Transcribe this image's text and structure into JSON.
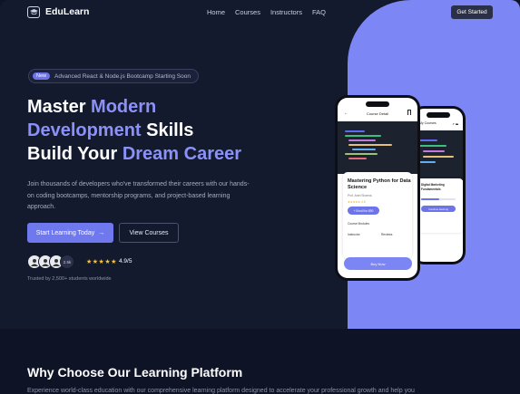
{
  "brand": {
    "name": "EduLearn"
  },
  "nav": {
    "links": [
      "Home",
      "Courses",
      "Instructors",
      "FAQ"
    ],
    "cta": "Get Started"
  },
  "hero": {
    "badge_tag": "New",
    "badge_text": "Advanced React & Node.js Bootcamp Starting Soon",
    "headline": {
      "part1": "Master ",
      "part2": "Modern",
      "part3": "Development",
      "part4": " Skills",
      "part5": "Build Your ",
      "part6": "Dream Career"
    },
    "description": "Join thousands of developers who've transformed their careers with our hands-on coding bootcamps, mentorship programs, and project-based learning approach.",
    "primary_button": "Start Learning Today",
    "primary_arrow": "→",
    "secondary_button": "View Courses",
    "avatar_count": "2.5k",
    "stars": "★★★★★",
    "rating": "4.9/5",
    "trusted": "Trusted by 2,500+ students worldwide"
  },
  "phone_front": {
    "header": "Course Detail",
    "course_title": "Mastering Python for Data Science",
    "author": "Prof. Aniel Sharma",
    "stars": "★★★★★ 4.8",
    "enroll": "+ Enroll for $90",
    "modules": "Course Modules",
    "instructor": "Instructor",
    "reviews": "Reviews",
    "buy": "Buy Now"
  },
  "phone_back": {
    "header": "My Courses",
    "course_title": "Digital Marketing Fundamentals",
    "button": "Continue learning"
  },
  "section": {
    "title": "Why Choose Our Learning Platform",
    "subtitle": "Experience world-class education with our comprehensive learning platform designed to accelerate your professional growth and help you"
  },
  "colors": {
    "accent": "#7078ee",
    "panel": "#7c86f5",
    "background": "#131a2e"
  }
}
